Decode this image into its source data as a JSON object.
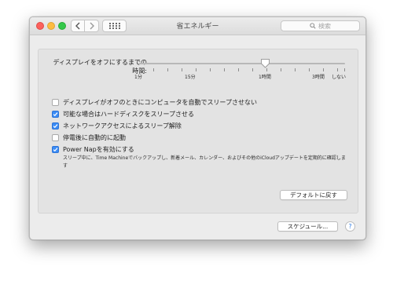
{
  "window": {
    "title": "省エネルギー"
  },
  "toolbar": {
    "search_placeholder": "検索"
  },
  "slider": {
    "label": "ディスプレイをオフにするまでの時間:",
    "ticks": [
      "1分",
      "15分",
      "1時間",
      "3時間",
      "しない"
    ],
    "current": "1時間"
  },
  "options": [
    {
      "label": "ディスプレイがオフのときにコンピュータを自動でスリープさせない",
      "checked": false
    },
    {
      "label": "可能な場合はハードディスクをスリープさせる",
      "checked": true
    },
    {
      "label": "ネットワークアクセスによるスリープ解除",
      "checked": true
    },
    {
      "label": "停電後に自動的に起動",
      "checked": false
    },
    {
      "label": "Power Napを有効にする",
      "checked": true
    }
  ],
  "power_nap_note": "スリープ中に、Time Machineでバックアップし、新着メール、カレンダー、およびその他のiCloudアップデートを定期的に確認します",
  "buttons": {
    "restore_defaults": "デフォルトに戻す",
    "schedule": "スケジュール...",
    "help": "?"
  }
}
